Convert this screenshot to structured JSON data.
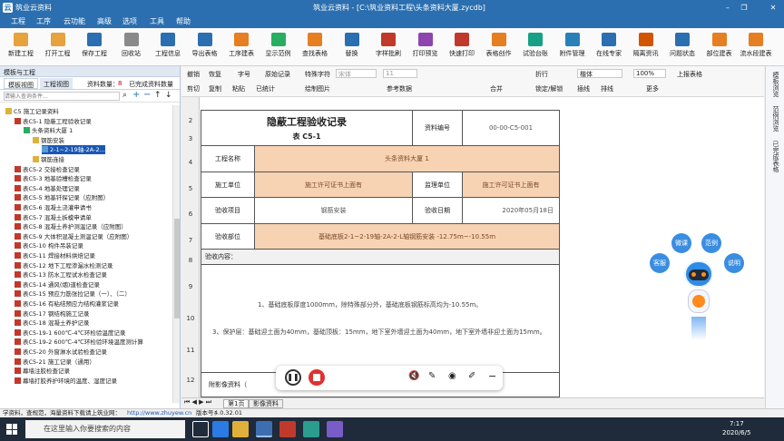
{
  "titlebar": {
    "app": "筑业云资料",
    "doc": "筑业云资料 - [C:\\筑业资料工程\\头条资料大厦.zycdb]",
    "min": "–",
    "max": "□",
    "close": "✕",
    "restore": "❐"
  },
  "menu": [
    "工程",
    "工序",
    "云功能",
    "高级",
    "选项",
    "工具",
    "帮助"
  ],
  "toolbar": [
    "新建工程",
    "打开工程",
    "保存工程",
    "回收站",
    "工程信息",
    "导出表格",
    "工序建表",
    "显示范例",
    "查找表格",
    "替换",
    "字样批刷",
    "打印预览",
    "快速打印",
    "表格创作",
    "试验台账",
    "附件管理",
    "在线专家",
    "隔离资讯",
    "问题状态",
    "部位建表",
    "流水段建表"
  ],
  "sidebar": {
    "title": "模板与工程",
    "tabs": [
      "模板视图",
      "工程视图"
    ],
    "count_label": "资料数量：",
    "count": "8",
    "filter": "已完成资料数量",
    "search_placeholder": "请输入查询条件...",
    "tree": [
      {
        "t": "C5 施工记录资料",
        "lvl": 0
      },
      {
        "t": "表C5-1 隐蔽工程验收记录",
        "lvl": 1
      },
      {
        "t": "头条资料大厦 1",
        "lvl": 2
      },
      {
        "t": "钢筋安装",
        "lvl": 3
      },
      {
        "t": "2-1~2-19轴-2A-2...",
        "lvl": 4
      },
      {
        "t": "钢筋连接",
        "lvl": 3
      },
      {
        "t": "表C5-2 交接检查记录",
        "lvl": 1
      },
      {
        "t": "表C5-3 地基验槽检查记录",
        "lvl": 1
      },
      {
        "t": "表C5-4 地基处理记录",
        "lvl": 1
      },
      {
        "t": "表C5-5 地基钎探记录（应附图）",
        "lvl": 1
      },
      {
        "t": "表C5-6 混凝土浇灌申请书",
        "lvl": 1
      },
      {
        "t": "表C5-7 混凝土拆模申请单",
        "lvl": 1
      },
      {
        "t": "表C5-8 混凝土养护测温记录（应附图）",
        "lvl": 1
      },
      {
        "t": "表C5-9 大体积混凝土测温记录（应附图）",
        "lvl": 1
      },
      {
        "t": "表C5-10 构件吊装记录",
        "lvl": 1
      },
      {
        "t": "表C5-11 焊接材料烘焙记录",
        "lvl": 1
      },
      {
        "t": "表C5-12 地下工程渗漏水检测记录",
        "lvl": 1
      },
      {
        "t": "表C5-13 防水工程试水检查记录",
        "lvl": 1
      },
      {
        "t": "表C5-14 通风(烟)道检查记录",
        "lvl": 1
      },
      {
        "t": "表C5-15 预应力筋张拉记录（一）、（二）",
        "lvl": 1
      },
      {
        "t": "表C5-16 有粘结预应力结构灌浆记录",
        "lvl": 1
      },
      {
        "t": "表C5-17 钢结构施工记录",
        "lvl": 1
      },
      {
        "t": "表C5-18 混凝土养护记录",
        "lvl": 1
      },
      {
        "t": "表C5-19-1 600℃-4℃环检验温度记录",
        "lvl": 1
      },
      {
        "t": "表C5-19-2 600℃-4℃环检验环境温度测计算",
        "lvl": 1
      },
      {
        "t": "表C5-20 外窗淋水试验检查记录",
        "lvl": 1
      },
      {
        "t": "表C5-21 施工记录（通用）",
        "lvl": 1
      },
      {
        "t": "幕墙注胶检查记录",
        "lvl": 1
      },
      {
        "t": "幕墙打胶养护环境的温度、湿度记录",
        "lvl": 1
      }
    ]
  },
  "format": {
    "row1": [
      "撤销",
      "恢复",
      "字号",
      "原始记录",
      "特殊字符",
      "宋体",
      "11",
      "折行",
      "楷体",
      "100%",
      "上报表格"
    ],
    "row2": [
      "剪切",
      "复制",
      "粘贴",
      "已统计",
      "绘制图片",
      "参考数据",
      "合并",
      "锁定/解锁",
      "插线",
      "排线",
      "更多"
    ]
  },
  "rowheaders": [
    "2",
    "3",
    "4",
    "5",
    "6",
    "7",
    "8",
    "9",
    "10",
    "11",
    "12"
  ],
  "form": {
    "title": "隐蔽工程验收记录",
    "subtitle": "表 C5-1",
    "doc_no_label": "资料编号",
    "doc_no": "00-00-C5-001",
    "project_label": "工程名称",
    "project": "头条资料大厦 1",
    "builder_label": "施工单位",
    "builder": "施工许可证书上面有",
    "supervisor_label": "监理单位",
    "supervisor": "施工许可证书上面有",
    "item_label": "验收项目",
    "item": "钢筋安装",
    "date_label": "验收日期",
    "date": "2020年05月18日",
    "part_label": "验收部位",
    "part": "基础底板2-1~2-19轴-2A-2-L轴钢筋安装  -12.75m~-10.55m",
    "content_label": "验收内容：",
    "line1": "1、基础底板厚度1000mm，除特殊部分外，基础底板钢筋标高均为-10.55m。",
    "line2": "3、保护层：基础迎土面为40mm，基础顶板：15mm，地下室外墙迎土面为40mm，地下室外墙非迎土面为15mm。",
    "attach_label": "附影像资料（"
  },
  "rightpanel": [
    "模板浏览",
    "范例浏览",
    "已完成表格"
  ],
  "assistant": [
    "微课",
    "范例",
    "客服",
    "说明"
  ],
  "sheettabs": [
    "第1页",
    "影像资料"
  ],
  "status": {
    "hint": "学资料，查规范，海量资料下载请上筑业网：",
    "url": "http://www.zhuyew.cn",
    "version_label": "版本号：",
    "version": "4.0.32.01"
  },
  "taskbar": {
    "search": "在这里输入你要搜索的内容",
    "time": "7:17",
    "date": "2020/6/5"
  }
}
